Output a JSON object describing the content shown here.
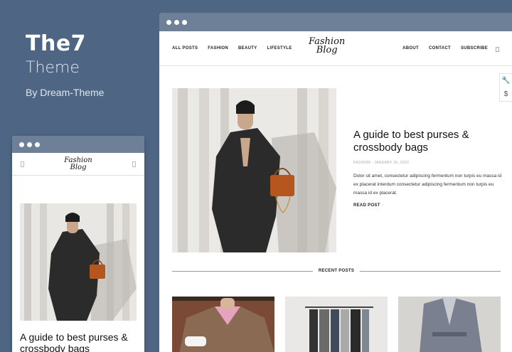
{
  "brand": {
    "name": "The7",
    "subtitle": "Theme",
    "byline": "By Dream-Theme"
  },
  "logo": {
    "line1": "Fashion",
    "line2": "Blog"
  },
  "nav": {
    "left": [
      "ALL POSTS",
      "FASHION",
      "BEAUTY",
      "LIFESTYLE"
    ],
    "right": [
      "ABOUT",
      "CONTACT",
      "SUBSCRIBE"
    ]
  },
  "post": {
    "title": "A guide to best purses & crossbody bags",
    "meta": "FASHION · JANUARY 26, 2022",
    "excerpt": "Dolor sit amet, consectetur adipiscing fermentum non turpis eu massa id ex placerat interdum consectetur adipiscing fermentum non turpis eu massa id ex placerat.",
    "read_more": "READ POST"
  },
  "mobile": {
    "title": "A guide to best purses & crossbody bags"
  },
  "recent_label": "RECENT POSTS",
  "colors": {
    "background": "#4e6683",
    "window_bar": "#6d8098",
    "bag": "#b5561f",
    "jacket": "#2b2b2b"
  },
  "icons": {
    "tools": "wrench-icon",
    "price": "dollar-icon"
  }
}
